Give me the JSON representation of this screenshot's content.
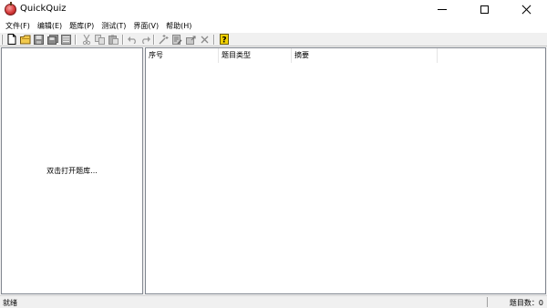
{
  "window": {
    "title": "QuickQuiz"
  },
  "menu": [
    "文件(F)",
    "编辑(E)",
    "题库(P)",
    "测试(T)",
    "界面(V)",
    "帮助(H)"
  ],
  "toolbar": {
    "icons": [
      "new-file-icon",
      "open-folder-icon",
      "save-icon",
      "save-all-icon",
      "properties-icon",
      "cut-icon",
      "copy-icon",
      "paste-icon",
      "undo-icon",
      "redo-icon",
      "new-question-icon",
      "edit-question-icon",
      "import-icon",
      "delete-icon",
      "help-icon"
    ]
  },
  "left_pane": {
    "hint": "双击打开题库..."
  },
  "list": {
    "columns": [
      "序号",
      "题目类型",
      "摘要"
    ]
  },
  "status": {
    "left": "就绪",
    "right": "题目数：0"
  },
  "colors": {
    "toolbar_bg": "#f0f0f0",
    "border": "#828790",
    "app_icon": "#d63a3a",
    "help_icon": "#f0d000"
  }
}
